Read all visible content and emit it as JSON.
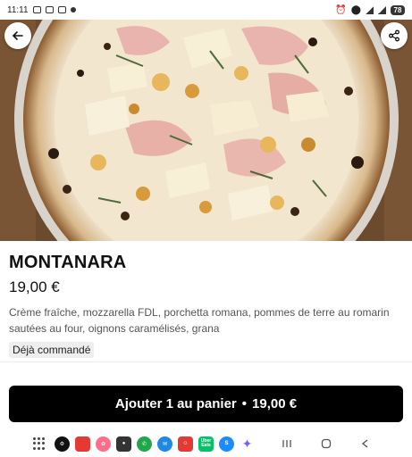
{
  "status_bar": {
    "time": "11:11",
    "battery": "78"
  },
  "product": {
    "name": "MONTANARA",
    "price": "19,00 €",
    "description": "Crème fraîche, mozzarella FDL, porchetta romana, pommes de terre au romarin sautées au four, oignons caramélisés, grana",
    "badge": "Déjà commandé"
  },
  "cta": {
    "label": "Ajouter 1 au panier",
    "separator": "•",
    "price": "19,00 €"
  },
  "dock_apps": [
    {
      "icon": "settings-app-icon",
      "color": "#111111"
    },
    {
      "icon": "red-app-icon",
      "color": "#e53935"
    },
    {
      "icon": "photos-app-icon",
      "color": "#ff6d8a"
    },
    {
      "icon": "camera-app-icon",
      "color": "#333333"
    },
    {
      "icon": "phone-app-icon",
      "color": "#21a649"
    },
    {
      "icon": "messages-app-icon",
      "color": "#1e88e5"
    },
    {
      "icon": "contacts-app-icon",
      "color": "#e53935"
    },
    {
      "icon": "ubereats-app-icon",
      "color": "#06c167",
      "text": "Uber Eats"
    },
    {
      "icon": "shazam-app-icon",
      "color": "#1a8cff"
    },
    {
      "icon": "gemini-app-icon",
      "color": "#7c5cff"
    }
  ],
  "colors": {
    "cta_background": "#000000",
    "badge_background": "#eeeeee",
    "description_text": "#545454"
  }
}
